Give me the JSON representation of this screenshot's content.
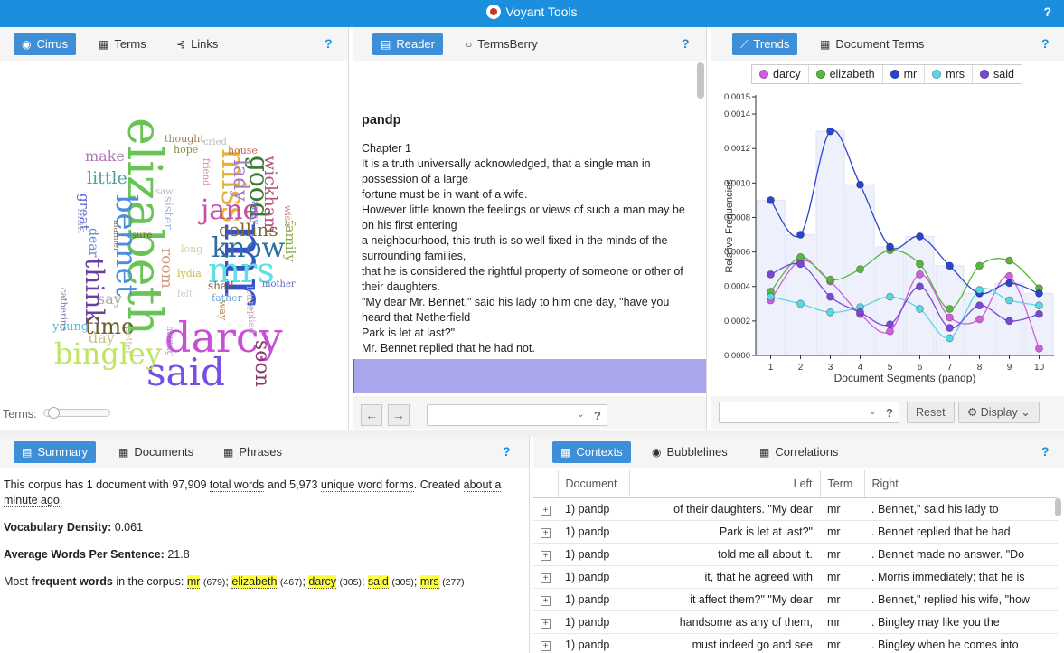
{
  "app": {
    "title": "Voyant Tools",
    "help": "?"
  },
  "cirrus_panel": {
    "tabs": [
      {
        "label": "Cirrus",
        "icon": "eye-icon"
      },
      {
        "label": "Terms",
        "icon": "table-icon"
      },
      {
        "label": "Links",
        "icon": "share-icon"
      }
    ],
    "help": "?",
    "terms_label": "Terms:",
    "words": [
      {
        "text": "elizabeth",
        "color": "#69c455"
      },
      {
        "text": "mr",
        "color": "#3650c9"
      },
      {
        "text": "miss",
        "color": "#e6b13a"
      },
      {
        "text": "darcy",
        "color": "#c84ed5"
      },
      {
        "text": "mrs",
        "color": "#5fe0e6"
      },
      {
        "text": "said",
        "color": "#7750e3"
      },
      {
        "text": "bingley",
        "color": "#bde65e"
      },
      {
        "text": "bennet",
        "color": "#4b8de0"
      },
      {
        "text": "jane",
        "color": "#c451a8"
      },
      {
        "text": "know",
        "color": "#2b6f9e"
      },
      {
        "text": "good",
        "color": "#3a7a2c"
      },
      {
        "text": "lady",
        "color": "#a07cc8"
      },
      {
        "text": "collins",
        "color": "#7a6b2a"
      },
      {
        "text": "wickham",
        "color": "#b0567a"
      },
      {
        "text": "think",
        "color": "#6a3fa0"
      },
      {
        "text": "time",
        "color": "#6d5a2d"
      },
      {
        "text": "soon",
        "color": "#8a3a6a"
      },
      {
        "text": "little",
        "color": "#4aa39a"
      },
      {
        "text": "make",
        "color": "#b07ab8"
      },
      {
        "text": "family",
        "color": "#8aae46"
      },
      {
        "text": "room",
        "color": "#d29c84"
      },
      {
        "text": "say",
        "color": "#a9a9a9"
      },
      {
        "text": "day",
        "color": "#c5c08e"
      },
      {
        "text": "young",
        "color": "#5ab6c9"
      },
      {
        "text": "great",
        "color": "#5a6bd0"
      },
      {
        "text": "dear",
        "color": "#5d8ce0"
      },
      {
        "text": "sister",
        "color": "#a8b6d6"
      },
      {
        "text": "thought",
        "color": "#98844a"
      },
      {
        "text": "hope",
        "color": "#7d8f3d"
      },
      {
        "text": "house",
        "color": "#c9655a"
      },
      {
        "text": "cried",
        "color": "#bbbbbb"
      },
      {
        "text": "friend",
        "color": "#cc88aa"
      },
      {
        "text": "away",
        "color": "#6a7bd5"
      },
      {
        "text": "wish",
        "color": "#c07a8a"
      },
      {
        "text": "shall",
        "color": "#7d5b3a"
      },
      {
        "text": "father",
        "color": "#6fa7d8"
      },
      {
        "text": "mother",
        "color": "#5c69b8"
      },
      {
        "text": "letter",
        "color": "#aaaaaa"
      },
      {
        "text": "replied",
        "color": "#c8a0c8"
      },
      {
        "text": "way",
        "color": "#b88a4a"
      },
      {
        "text": "long",
        "color": "#c7d6a0"
      },
      {
        "text": "lydia",
        "color": "#d0b84a"
      },
      {
        "text": "felt",
        "color": "#cccccc"
      },
      {
        "text": "having",
        "color": "#a58ad6"
      },
      {
        "text": "catherine",
        "color": "#7e6aa8"
      },
      {
        "text": "man",
        "color": "#c8b0d8"
      },
      {
        "text": "manner",
        "color": "#8a7a6a"
      },
      {
        "text": "better",
        "color": "#cbbfa4"
      },
      {
        "text": "sure",
        "color": "#7a5a2a"
      },
      {
        "text": "saw",
        "color": "#b9b9b9"
      }
    ]
  },
  "reader_panel": {
    "tabs": [
      {
        "label": "Reader",
        "icon": "document-icon"
      },
      {
        "label": "TermsBerry",
        "icon": "circle-icon"
      }
    ],
    "help": "?",
    "doc_title": "pandp",
    "lines": [
      "Chapter 1",
      "It is a truth universally acknowledged, that a single man in possession of a large",
      "fortune must be in want of a wife.",
      "However little known the feelings or views of such a man may be on his first entering",
      "a neighbourhood, this truth is so well fixed in the minds of the surrounding families,",
      "that he is considered the rightful property of someone or other of their daughters.",
      "\"My dear Mr. Bennet,\" said his lady to him one day, \"have you heard that Netherfield",
      "Park is let at last?\"",
      "Mr. Bennet replied that he had not."
    ],
    "search_help": "?"
  },
  "trends_panel": {
    "tabs": [
      {
        "label": "Trends",
        "icon": "line-chart-icon"
      },
      {
        "label": "Document Terms",
        "icon": "table-icon"
      }
    ],
    "help": "?",
    "legend": [
      {
        "name": "darcy",
        "color": "#d15fe0"
      },
      {
        "name": "elizabeth",
        "color": "#58b83c"
      },
      {
        "name": "mr",
        "color": "#2a44cf"
      },
      {
        "name": "mrs",
        "color": "#5ad8e0"
      },
      {
        "name": "said",
        "color": "#7a48d8"
      }
    ],
    "reset_label": "Reset",
    "display_label": "Display",
    "search_help": "?"
  },
  "chart_data": {
    "type": "line",
    "xlabel": "Document Segments (pandp)",
    "ylabel": "Relative Frequencies",
    "x": [
      1,
      2,
      3,
      4,
      5,
      6,
      7,
      8,
      9,
      10
    ],
    "ylim": [
      0,
      0.0015
    ],
    "yticks": [
      "0.0000",
      "0.0002",
      "0.0004",
      "0.0006",
      "0.0008",
      "0.0010",
      "0.0012",
      "0.0014",
      "0.0015"
    ],
    "yticks_values": [
      0,
      0.0002,
      0.0004,
      0.0006,
      0.0008,
      0.001,
      0.0012,
      0.0014,
      0.0015
    ],
    "bars_series": "mr",
    "series": [
      {
        "name": "darcy",
        "color": "#d15fe0",
        "values": [
          0.00032,
          0.00055,
          0.00043,
          0.00024,
          0.00014,
          0.00047,
          0.00022,
          0.00021,
          0.00046,
          4e-05
        ]
      },
      {
        "name": "elizabeth",
        "color": "#58b83c",
        "values": [
          0.00037,
          0.00057,
          0.00044,
          0.0005,
          0.00061,
          0.00053,
          0.00027,
          0.00052,
          0.00055,
          0.00039
        ]
      },
      {
        "name": "mr",
        "color": "#2a44cf",
        "values": [
          0.0009,
          0.0007,
          0.0013,
          0.00099,
          0.00063,
          0.00069,
          0.00052,
          0.00036,
          0.00042,
          0.00036
        ]
      },
      {
        "name": "mrs",
        "color": "#5ad8e0",
        "values": [
          0.00034,
          0.0003,
          0.00025,
          0.00028,
          0.00034,
          0.00027,
          0.0001,
          0.00038,
          0.00032,
          0.00029
        ]
      },
      {
        "name": "said",
        "color": "#7a48d8",
        "values": [
          0.00047,
          0.00053,
          0.00034,
          0.00025,
          0.00018,
          0.0004,
          0.00016,
          0.00029,
          0.0002,
          0.00024
        ]
      }
    ]
  },
  "summary_panel": {
    "tabs": [
      {
        "label": "Summary",
        "icon": "summary-icon"
      },
      {
        "label": "Documents",
        "icon": "table-icon"
      },
      {
        "label": "Phrases",
        "icon": "table-icon"
      }
    ],
    "help": "?",
    "corpus_prefix": "This corpus has 1 document with 97,909 ",
    "total_words": "total words",
    "corpus_mid": " and 5,973 ",
    "unique_forms": "unique word forms",
    "corpus_end": ". Created ",
    "created_ago": "about a minute ago",
    "corpus_period": ".",
    "density_label": "Vocabulary Density:",
    "density_value": "0.061",
    "awps_label": "Average Words Per Sentence:",
    "awps_value": "21.8",
    "most_prefix": "Most ",
    "most_bold": "frequent words",
    "most_suffix": " in the corpus: ",
    "frequent": [
      {
        "word": "mr",
        "count": "(679)"
      },
      {
        "word": "elizabeth",
        "count": "(467)"
      },
      {
        "word": "darcy",
        "count": "(305)"
      },
      {
        "word": "said",
        "count": "(305)"
      },
      {
        "word": "mrs",
        "count": "(277)"
      }
    ]
  },
  "contexts_panel": {
    "tabs": [
      {
        "label": "Contexts",
        "icon": "table-icon"
      },
      {
        "label": "Bubblelines",
        "icon": "eye-icon"
      },
      {
        "label": "Correlations",
        "icon": "table-icon"
      }
    ],
    "help": "?",
    "columns": [
      "Document",
      "Left",
      "Term",
      "Right"
    ],
    "rows": [
      {
        "doc": "1) pandp",
        "left": "of their daughters. \"My dear",
        "term": "mr",
        "right": ". Bennet,\" said his lady to"
      },
      {
        "doc": "1) pandp",
        "left": "Park is let at last?\"",
        "term": "mr",
        "right": ". Bennet replied that he had"
      },
      {
        "doc": "1) pandp",
        "left": "told me all about it.",
        "term": "mr",
        "right": ". Bennet made no answer. \"Do"
      },
      {
        "doc": "1) pandp",
        "left": "it, that he agreed with",
        "term": "mr",
        "right": ". Morris immediately; that he is"
      },
      {
        "doc": "1) pandp",
        "left": "it affect them?\" \"My dear",
        "term": "mr",
        "right": ". Bennet,\" replied his wife, \"how"
      },
      {
        "doc": "1) pandp",
        "left": "handsome as any of them,",
        "term": "mr",
        "right": ". Bingley may like you the"
      },
      {
        "doc": "1) pandp",
        "left": "must indeed go and see",
        "term": "mr",
        "right": ". Bingley when he comes into"
      }
    ]
  }
}
